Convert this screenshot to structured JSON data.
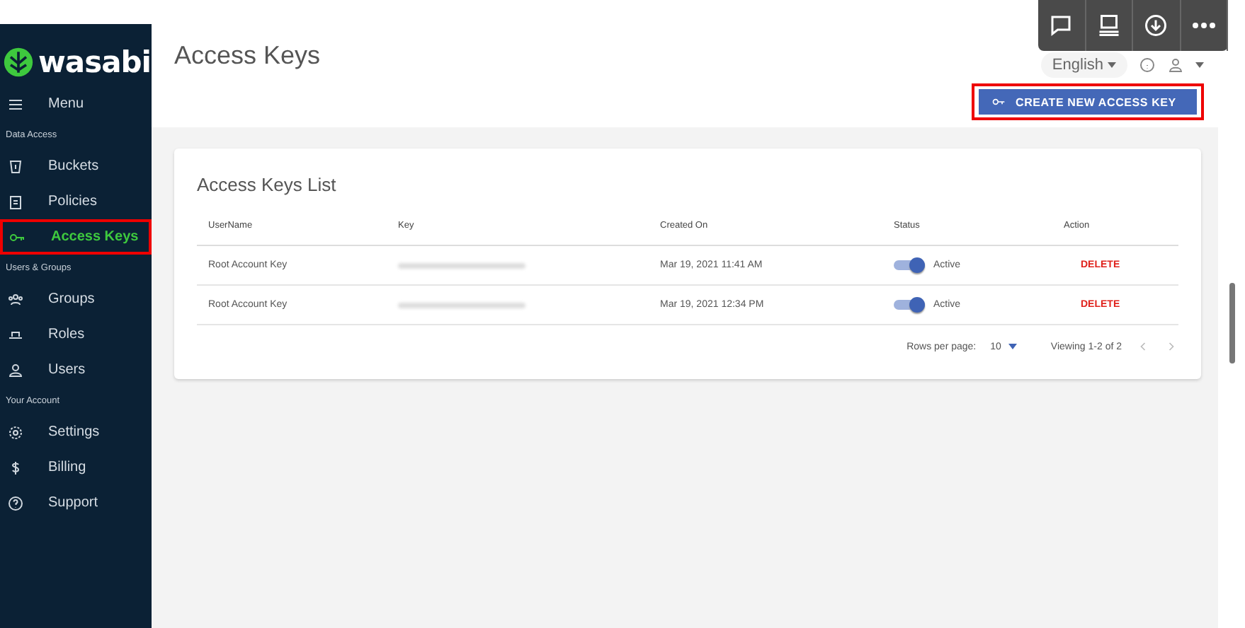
{
  "sidebar": {
    "logo": "wasabi",
    "menu_label": "Menu",
    "sections": [
      {
        "title": "Data Access",
        "items": [
          {
            "label": "Buckets",
            "selected": false
          },
          {
            "label": "Policies",
            "selected": false
          },
          {
            "label": "Access Keys",
            "selected": true
          }
        ]
      },
      {
        "title": "Users & Groups",
        "items": [
          {
            "label": "Groups",
            "selected": false
          },
          {
            "label": "Roles",
            "selected": false
          },
          {
            "label": "Users",
            "selected": false
          }
        ]
      },
      {
        "title": "Your Account",
        "items": [
          {
            "label": "Settings",
            "selected": false
          },
          {
            "label": "Billing",
            "selected": false
          },
          {
            "label": "Support",
            "selected": false
          }
        ]
      }
    ]
  },
  "header": {
    "title": "Access Keys",
    "language": "English",
    "create_button": "CREATE NEW ACCESS KEY"
  },
  "table": {
    "title": "Access Keys List",
    "columns": [
      "UserName",
      "Key",
      "Created On",
      "Status",
      "Action"
    ],
    "rows": [
      {
        "username": "Root Account Key",
        "created": "Mar 19, 2021 11:41 AM",
        "on": true,
        "status": "Active",
        "action": "DELETE"
      },
      {
        "username": "Root Account Key",
        "created": "Mar 19, 2021 12:34 PM",
        "on": true,
        "status": "Active",
        "action": "DELETE"
      }
    ],
    "rows_per_page_label": "Rows per page:",
    "rows_per_page": "10",
    "viewing": "Viewing 1-2 of 2"
  }
}
